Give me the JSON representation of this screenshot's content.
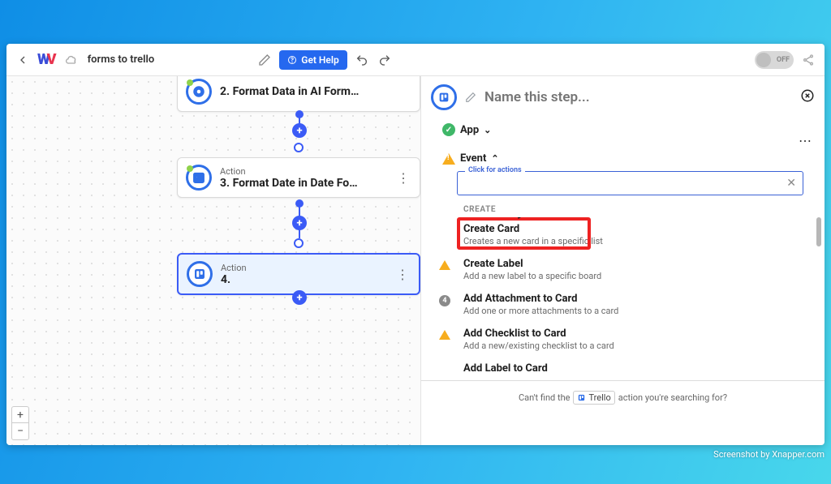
{
  "toolbar": {
    "title": "forms to trello",
    "help_label": "Get Help",
    "toggle_label": "OFF"
  },
  "canvas": {
    "nodes": [
      {
        "label": "",
        "title": "2. Format Data in AI Form…",
        "icon": "gear"
      },
      {
        "label": "Action",
        "title": "3. Format Date in Date Fo…",
        "icon": "calendar"
      },
      {
        "label": "Action",
        "title": "4.",
        "icon": "trello",
        "selected": true
      }
    ]
  },
  "panel": {
    "name_placeholder": "Name this step...",
    "app_label": "App",
    "event_label": "Event",
    "search_label": "Click for actions",
    "group_create": "CREATE",
    "actions": [
      {
        "title": "Create Card",
        "desc": "Creates a new card in a specific list",
        "icon": "none",
        "highlight": true
      },
      {
        "title": "Create Label",
        "desc": "Add a new label to a specific board",
        "icon": "warn"
      },
      {
        "title": "Add Attachment to Card",
        "desc": "Add one or more attachments to a card",
        "icon": "num",
        "num": "4"
      },
      {
        "title": "Add Checklist to Card",
        "desc": "Add a new/existing checklist to a card",
        "icon": "warn"
      },
      {
        "title": "Add Label to Card",
        "desc": "",
        "icon": "none"
      }
    ],
    "footer_pre": "Can't find the",
    "footer_app": "Trello",
    "footer_post": "action you're searching for?"
  },
  "watermark": "Screenshot by Xnapper.com"
}
